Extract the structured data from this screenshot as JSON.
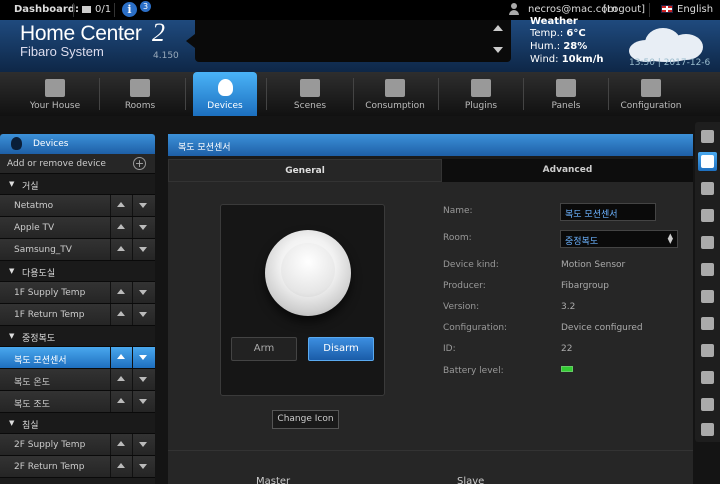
{
  "topbar": {
    "dashboard_label": "Dashboard:",
    "scenes_count": "0/1",
    "info_label": "i",
    "info_badge": "3",
    "email": "necros@mac.com",
    "logout": "[Logout]",
    "language": "English"
  },
  "header": {
    "logo_main": "Home Center",
    "logo_num": "2",
    "logo_sub": "Fibaro System",
    "version": "4.150",
    "weather_title": "Weather",
    "temp_label": "Temp.:",
    "temp_value": "6°C",
    "hum_label": "Hum.:",
    "hum_value": "28%",
    "wind_label": "Wind:",
    "wind_value": "10km/h",
    "time": "13:50",
    "date": "2017-12-6"
  },
  "nav": {
    "items": [
      {
        "label": "Your House",
        "icon": "house-icon"
      },
      {
        "label": "Rooms",
        "icon": "rooms-icon"
      },
      {
        "label": "Devices",
        "icon": "bulb-icon"
      },
      {
        "label": "Scenes",
        "icon": "clapper-icon"
      },
      {
        "label": "Consumption",
        "icon": "chart-icon"
      },
      {
        "label": "Plugins",
        "icon": "plugin-icon"
      },
      {
        "label": "Panels",
        "icon": "puzzle-icon"
      },
      {
        "label": "Configuration",
        "icon": "gears-icon"
      }
    ],
    "active": 2
  },
  "sidebar": {
    "title": "Devices",
    "add_label": "Add or remove device",
    "groups": [
      {
        "name": "거실",
        "devices": [
          "Netatmo",
          "Apple TV",
          "Samsung_TV"
        ]
      },
      {
        "name": "다용도실",
        "devices": [
          "1F Supply Temp",
          "1F Return Temp"
        ]
      },
      {
        "name": "중정복도",
        "devices": [
          "복도 모션센서",
          "복도 온도",
          "복도 조도"
        ]
      },
      {
        "name": "침실",
        "devices": [
          "2F Supply Temp",
          "2F Return Temp"
        ]
      }
    ],
    "selected": "복도 모션센서"
  },
  "main": {
    "title": "복도 모션센서",
    "tabs": {
      "general": "General",
      "advanced": "Advanced"
    },
    "arm": "Arm",
    "disarm": "Disarm",
    "change_icon": "Change Icon",
    "props": {
      "name_label": "Name:",
      "name_value": "복도 모션센서",
      "room_label": "Room:",
      "room_value": "중정복도",
      "kind_label": "Device kind:",
      "kind_value": "Motion Sensor",
      "producer_label": "Producer:",
      "producer_value": "Fibargroup",
      "version_label": "Version:",
      "version_value": "3.2",
      "config_label": "Configuration:",
      "config_value": "Device configured",
      "id_label": "ID:",
      "id_value": "22",
      "battery_label": "Battery level:"
    },
    "master_label": "Master",
    "slave_label": "Slave"
  },
  "colors": {
    "accent": "#2b7fd4",
    "header_bg": "#1a3d66",
    "background": "#141414"
  }
}
